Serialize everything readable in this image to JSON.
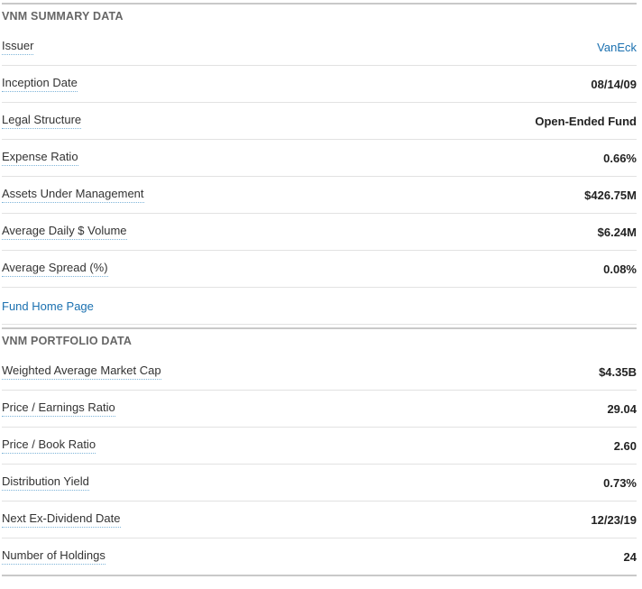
{
  "summary": {
    "title": "VNM SUMMARY DATA",
    "rows": [
      {
        "label": "Issuer",
        "value": "VanEck"
      },
      {
        "label": "Inception Date",
        "value": "08/14/09"
      },
      {
        "label": "Legal Structure",
        "value": "Open-Ended Fund"
      },
      {
        "label": "Expense Ratio",
        "value": "0.66%"
      },
      {
        "label": "Assets Under Management",
        "value": "$426.75M"
      },
      {
        "label": "Average Daily $ Volume",
        "value": "$6.24M"
      },
      {
        "label": "Average Spread (%)",
        "value": "0.08%"
      }
    ],
    "fund_home_link": "Fund Home Page"
  },
  "portfolio": {
    "title": "VNM PORTFOLIO DATA",
    "rows": [
      {
        "label": "Weighted Average Market Cap",
        "value": "$4.35B"
      },
      {
        "label": "Price / Earnings Ratio",
        "value": "29.04"
      },
      {
        "label": "Price / Book Ratio",
        "value": "2.60"
      },
      {
        "label": "Distribution Yield",
        "value": "0.73%"
      },
      {
        "label": "Next Ex-Dividend Date",
        "value": "12/23/19"
      },
      {
        "label": "Number of Holdings",
        "value": "24"
      }
    ]
  },
  "colors": {
    "link": "#1a70b0",
    "header_text": "#666666",
    "divider": "#c9c9c9"
  }
}
